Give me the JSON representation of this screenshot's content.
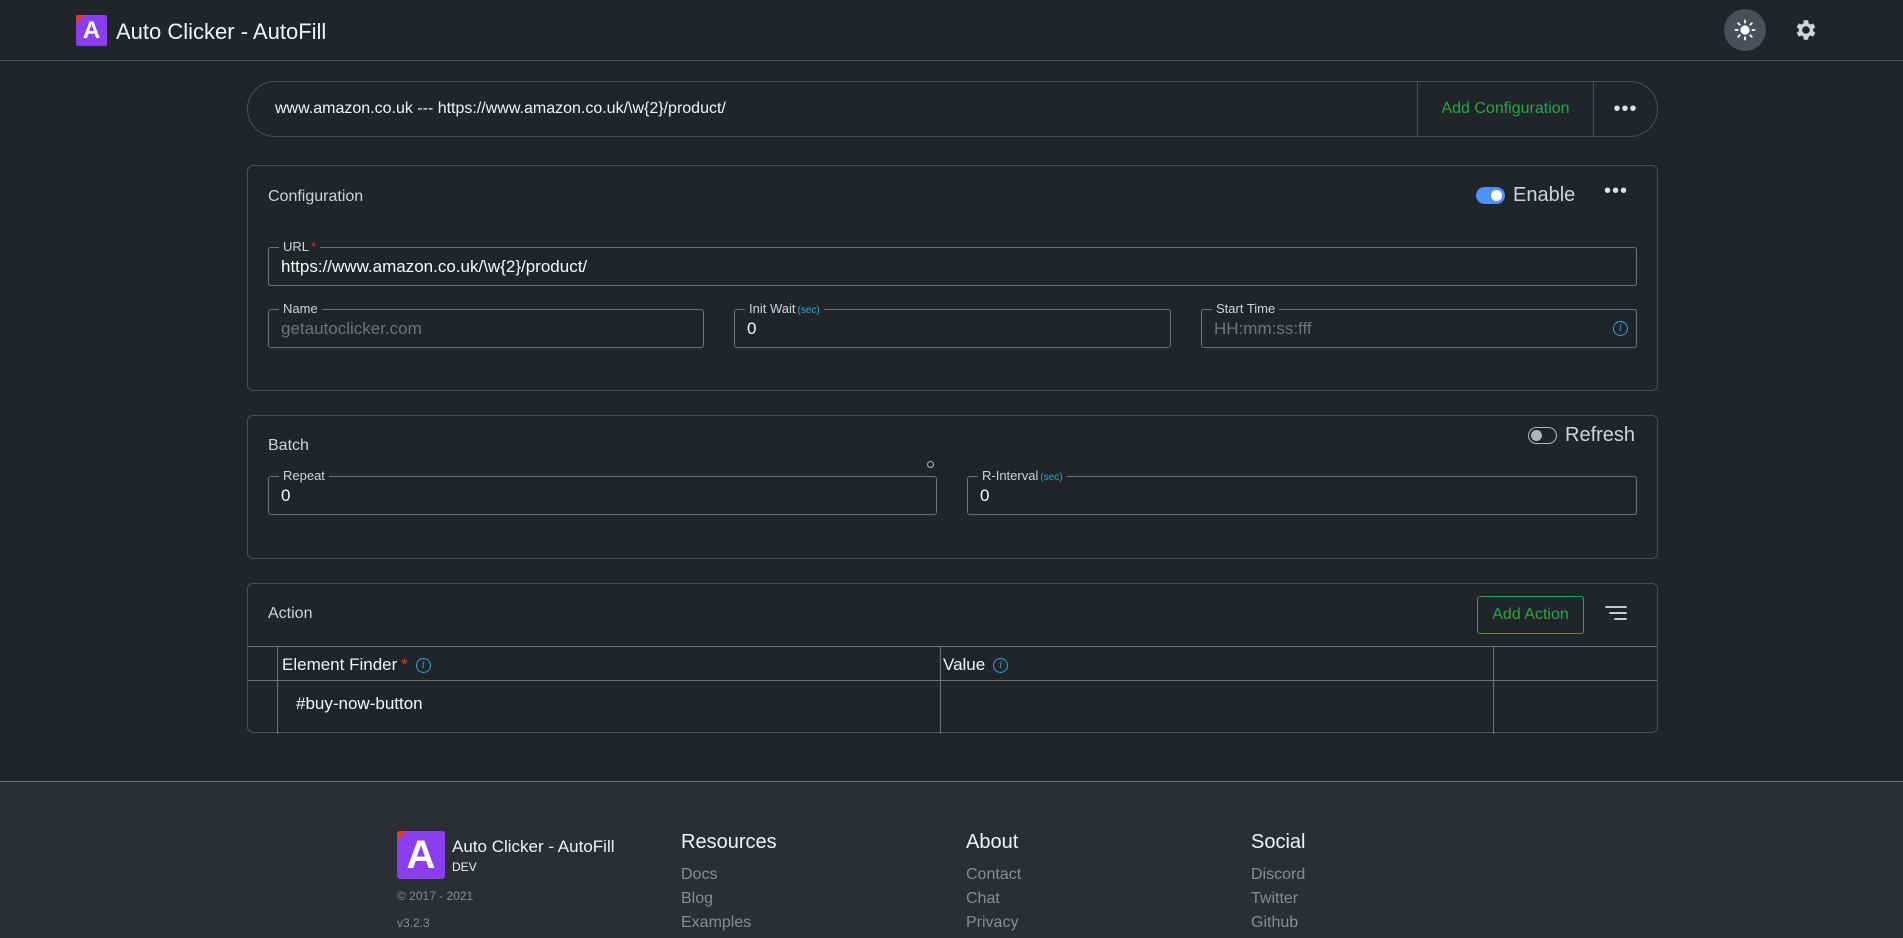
{
  "header": {
    "logo_letter": "A",
    "title": "Auto Clicker - AutoFill",
    "theme_icon": "sun-icon",
    "settings_icon": "gear-icon"
  },
  "selector": {
    "current": "www.amazon.co.uk --- https://www.amazon.co.uk/\\w{2}/product/",
    "add_label": "Add Configuration",
    "more_label": "•••"
  },
  "configuration": {
    "title": "Configuration",
    "enable_label": "Enable",
    "enabled": true,
    "more_label": "•••",
    "url": {
      "label": "URL",
      "required_mark": "*",
      "value": "https://www.amazon.co.uk/\\w{2}/product/"
    },
    "name": {
      "label": "Name",
      "value": "",
      "placeholder": "getautoclicker.com"
    },
    "init_wait": {
      "label": "Init Wait",
      "unit": "(sec)",
      "value": "0"
    },
    "start_time": {
      "label": "Start Time",
      "value": "",
      "placeholder": "HH:mm:ss:fff",
      "info": "i"
    }
  },
  "batch": {
    "title": "Batch",
    "refresh_label": "Refresh",
    "refresh_enabled": false,
    "repeat": {
      "label": "Repeat",
      "value": "0"
    },
    "r_interval": {
      "label": "R-Interval",
      "unit": "(sec)",
      "value": "0"
    }
  },
  "action": {
    "title": "Action",
    "add_label": "Add Action",
    "columns": [
      {
        "label": "Element Finder",
        "required_mark": "*",
        "info": "i"
      },
      {
        "label": "Value",
        "info": "i"
      }
    ],
    "rows": [
      {
        "element_finder": "#buy-now-button",
        "value": ""
      }
    ]
  },
  "footer": {
    "logo_letter": "A",
    "name": "Auto Clicker - AutoFill",
    "badge": "DEV",
    "copyright": "© 2017 - 2021",
    "version": "v3.2.3",
    "columns": [
      {
        "heading": "Resources",
        "links": [
          "Docs",
          "Blog",
          "Examples"
        ]
      },
      {
        "heading": "About",
        "links": [
          "Contact",
          "Chat",
          "Privacy"
        ]
      },
      {
        "heading": "Social",
        "links": [
          "Discord",
          "Twitter",
          "Github"
        ]
      }
    ]
  }
}
